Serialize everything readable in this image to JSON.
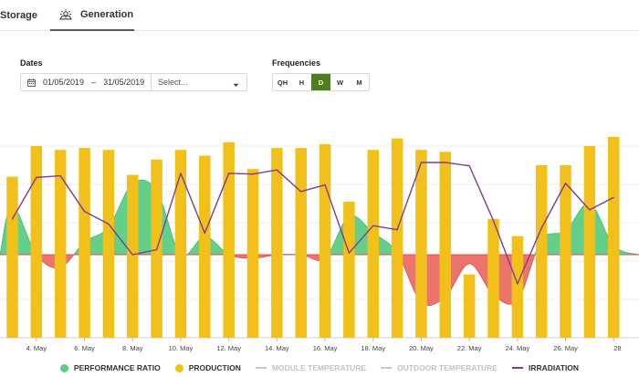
{
  "tabs": {
    "storage": "Storage",
    "generation": "Generation",
    "generation_icon": "sun-panel-icon"
  },
  "dates": {
    "label": "Dates",
    "from": "01/05/2019",
    "separator": "–",
    "to": "31/05/2019",
    "select_placeholder": "Select..."
  },
  "frequencies": {
    "label": "Frequencies",
    "options": [
      "QH",
      "H",
      "D",
      "W",
      "M"
    ],
    "selected": "D"
  },
  "legend": {
    "performance_ratio": "PERFORMANCE RATIO",
    "production": "PRODUCTION",
    "module_temperature": "MODULE TEMPERATURE",
    "outdoor_temperature": "OUTDOOR TEMPERATURE",
    "irradiation": "IRRADIATION"
  },
  "colors": {
    "performance_ratio": "#5ccc82",
    "performance_ratio_negative": "#ea6e63",
    "production": "#f1c01a",
    "irradiation": "#7d3c98",
    "disabled": "#c8c8c8",
    "active_frequency": "#4f7f1d"
  },
  "chart_data": {
    "type": "bar",
    "x": [
      "2019-05-03",
      "2019-05-04",
      "2019-05-05",
      "2019-05-06",
      "2019-05-07",
      "2019-05-08",
      "2019-05-09",
      "2019-05-10",
      "2019-05-11",
      "2019-05-12",
      "2019-05-13",
      "2019-05-14",
      "2019-05-15",
      "2019-05-16",
      "2019-05-17",
      "2019-05-18",
      "2019-05-19",
      "2019-05-20",
      "2019-05-21",
      "2019-05-22",
      "2019-05-23",
      "2019-05-24",
      "2019-05-25",
      "2019-05-26",
      "2019-05-27",
      "2019-05-28"
    ],
    "xticks": [
      "4. May",
      "6. May",
      "8. May",
      "10. May",
      "12. May",
      "14. May",
      "16. May",
      "18. May",
      "20. May",
      "22. May",
      "24. May",
      "26. May",
      "28"
    ],
    "series": [
      {
        "name": "PRODUCTION",
        "values": [
          0.84,
          1.0,
          0.98,
          0.99,
          0.98,
          0.85,
          0.93,
          0.98,
          0.95,
          1.02,
          0.88,
          0.99,
          0.99,
          1.01,
          0.71,
          0.98,
          1.04,
          0.98,
          0.97,
          0.33,
          0.62,
          0.53,
          0.9,
          0.9,
          1.0,
          1.1
        ]
      },
      {
        "name": "PERFORMANCE RATIO",
        "values": [
          0.27,
          0.0,
          -0.07,
          0.07,
          0.15,
          0.39,
          0.35,
          0.0,
          0.1,
          0.0,
          -0.02,
          0.0,
          0.0,
          -0.02,
          0.21,
          0.12,
          0.01,
          -0.26,
          -0.23,
          -0.05,
          -0.22,
          -0.25,
          0.08,
          0.13,
          0.28,
          0.05
        ]
      },
      {
        "name": "IRRADIATION",
        "values": [
          0.43,
          0.93,
          0.95,
          0.52,
          0.37,
          0.0,
          0.06,
          0.98,
          0.26,
          0.98,
          0.97,
          1.02,
          0.76,
          0.84,
          0.02,
          0.35,
          0.3,
          1.11,
          1.11,
          1.07,
          0.41,
          -0.35,
          0.32,
          0.86,
          0.54,
          0.69
        ]
      }
    ]
  }
}
